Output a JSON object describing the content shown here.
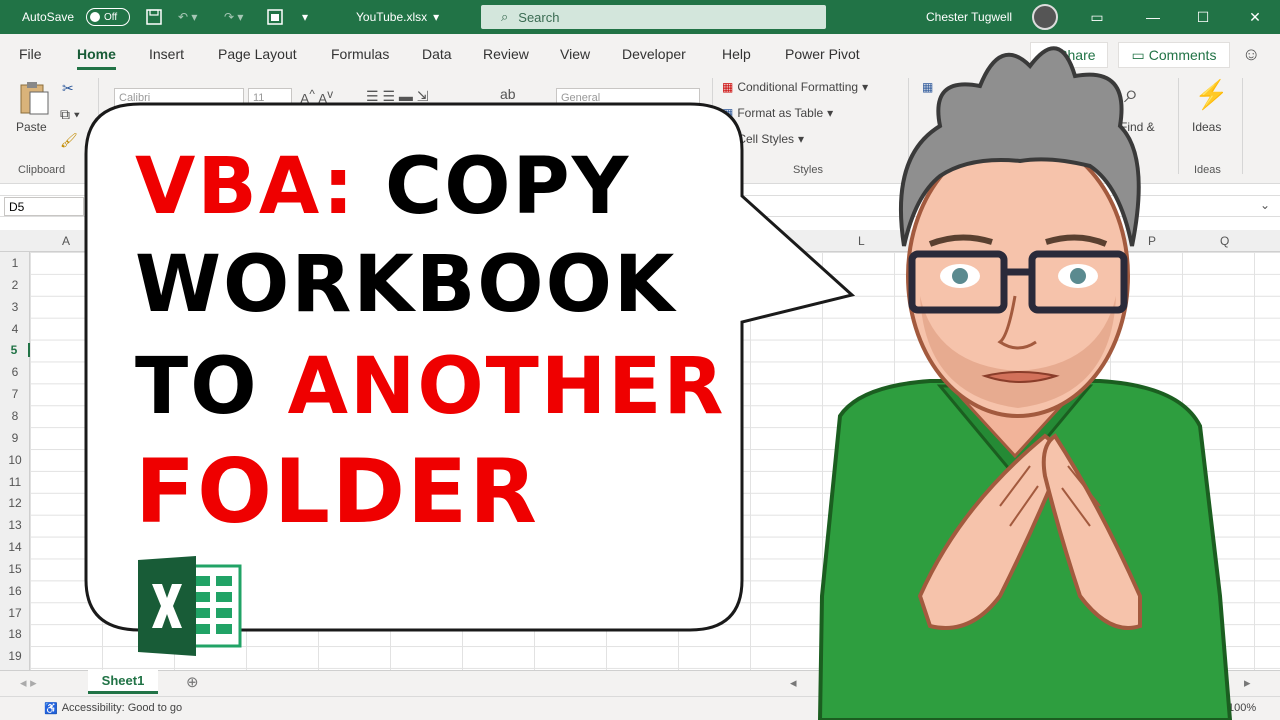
{
  "titlebar": {
    "autosave_label": "AutoSave",
    "autosave_state": "Off",
    "file_name": "YouTube.xlsx",
    "search_placeholder": "Search",
    "user_name": "Chester Tugwell"
  },
  "ribbon_tabs": [
    "File",
    "Home",
    "Insert",
    "Page Layout",
    "Formulas",
    "Data",
    "Review",
    "View",
    "Developer",
    "Help",
    "Power Pivot"
  ],
  "ribbon_actions": {
    "share": "Share",
    "comments": "Comments"
  },
  "ribbon": {
    "paste": "Paste",
    "clipboard_label": "Clipboard",
    "font_name": "Calibri",
    "font_size": "11",
    "number_format": "General",
    "conditional_formatting": "Conditional Formatting",
    "format_as_table": "Format as Table",
    "cell_styles": "Cell Styles",
    "styles_label": "Styles",
    "find_select": "Find &",
    "ideas": "Ideas",
    "ideas_label": "Ideas"
  },
  "formula_bar": {
    "name_box": "D5"
  },
  "columns": {
    "a": "A",
    "l": "L",
    "p": "P",
    "q": "Q"
  },
  "rows": [
    "1",
    "2",
    "3",
    "4",
    "5",
    "6",
    "7",
    "8",
    "9",
    "10",
    "11",
    "12",
    "13",
    "14",
    "15",
    "16",
    "17",
    "18",
    "19"
  ],
  "sheet": {
    "tab": "Sheet1"
  },
  "status": {
    "accessibility": "Accessibility: Good to go",
    "zoom": "100%"
  },
  "thumbnail": {
    "line1_red": "VBA:",
    "line1_black": "COPY",
    "line2": "WORKBOOK",
    "line3_black": "TO",
    "line3_red": "ANOTHER",
    "line4": "FOLDER"
  },
  "colors": {
    "excel_green": "#217346",
    "title_red": "#ef0000"
  }
}
